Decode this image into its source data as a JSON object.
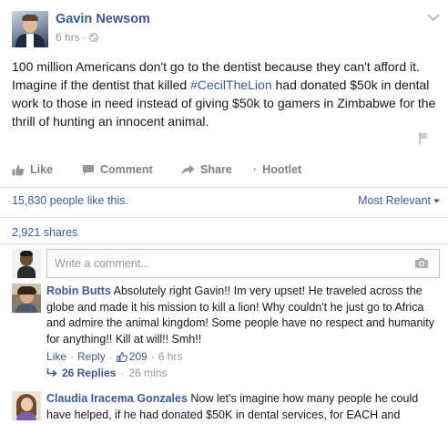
{
  "post": {
    "author": "Gavin Newsom",
    "time": "6 hrs",
    "separator": "·",
    "text_before_hashtag": "100 million Americans don't go to the dentist because they can't afford it. Imagine if the dentist that killed ",
    "hashtag": "#CecilTheLion",
    "text_after_hashtag": " had donated $50k in dental work to those in need instead of giving $50k to gamers in Zimbabwe for the thrill of hunting an innocent animal."
  },
  "actions": {
    "like": "Like",
    "comment": "Comment",
    "share": "Share",
    "hootlet": "Hootlet",
    "hootlet_prefix": "·"
  },
  "stats": {
    "likes": "15,830 people like this.",
    "sort": "Most Relevant",
    "shares": "2,921 shares"
  },
  "composer": {
    "placeholder": "Write a comment..."
  },
  "comments": [
    {
      "author": "Robin Butts",
      "text": "Absolutely right Gavin!! Im very upset! He traveled across the globe and made it his mission to kill a lion! Why couldn't he just go to Africa and admire the animal kingdom! Some people have no respect and humanity for anything!! Kill at will!! Smh!!",
      "like": "Like",
      "reply": "Reply",
      "likes": "209",
      "time": "6 hrs",
      "replies": "26 Replies",
      "replies_time": "26 mins"
    },
    {
      "author": "Claudia Iracema Gonzales",
      "text": "Now let's imagine how many people he could have helped, if he had donated $50K in dental services, for EACH and EVERY"
    }
  ],
  "colors": {
    "link": "#3b5998",
    "muted": "#9197a3",
    "divider": "#e1e2e3"
  }
}
